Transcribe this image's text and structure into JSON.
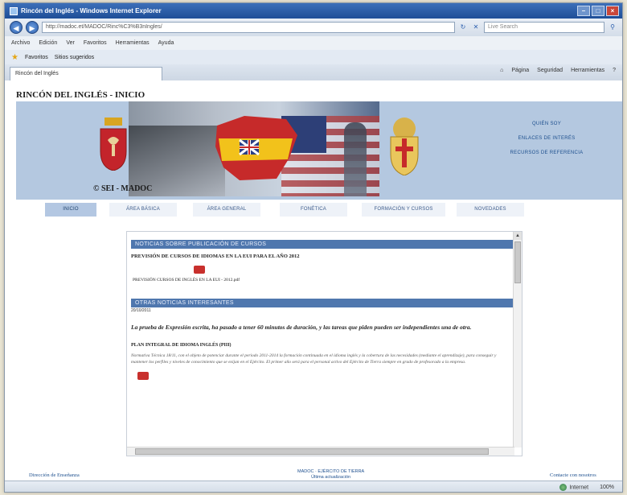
{
  "window": {
    "title": "Rincón del Inglés - Windows Internet Explorer"
  },
  "addressbar": {
    "url": "http://madoc.et/MADOC/Rinc%C3%B3nIngles/",
    "search_placeholder": "Live Search"
  },
  "menubar": {
    "items": [
      "Archivo",
      "Edición",
      "Ver",
      "Favoritos",
      "Herramientas",
      "Ayuda"
    ]
  },
  "favbar": {
    "favorites_label": "Favoritos",
    "suggested_label": "Sitios sugeridos"
  },
  "tabbar": {
    "tab_label": "Rincón del Inglés",
    "tools": [
      "Página",
      "Seguridad",
      "Herramientas"
    ]
  },
  "page": {
    "title": "RINCÓN DEL INGLÉS - INICIO",
    "copyright": "© SEI - MADOC",
    "banner_links": [
      "QUIÉN SOY",
      "ENLACES DE INTERÉS",
      "RECURSOS DE REFERENCIA"
    ],
    "nav": [
      {
        "label": "INICIO",
        "active": true
      },
      {
        "label": "ÁREA BÁSICA",
        "active": false
      },
      {
        "label": "ÁREA GENERAL",
        "active": false
      },
      {
        "label": "FONÉTICA",
        "active": false
      },
      {
        "label": "FORMACIÓN Y CURSOS",
        "active": false
      },
      {
        "label": "NOVEDADES",
        "active": false
      }
    ]
  },
  "panel": {
    "section1_head": "NOTICIAS SOBRE PUBLICACIÓN DE CURSOS",
    "section1_text": "PREVISIÓN DE CURSOS DE IDIOMAS EN LA EUI PARA EL AÑO 2012",
    "pdf_label": "PREVISIÓN CURSOS DE INGLÉS EN LA EUI - 2012.pdf",
    "section2_head": "OTRAS NOTICIAS INTERESANTES",
    "section2_date": "20/10/2011",
    "italic_text": "La prueba de Expresión escrita, ha pasado a tener 60 minutos de duración, y las tareas que piden pueden ser independientes una de otra.",
    "plan_title": "PLAN INTEGRAL DE IDIOMA INGLÉS (PIII)",
    "plan_text": "Normativa Técnica 18/11, con el objeto de potenciar durante el periodo 2011-2014 la formación continuada en el idioma inglés y la cobertura de las necesidades (mediante el aprendizaje), para conseguir y mantener los perfiles y niveles de conocimiento que se exijan en el Ejército. El primer año será para el personal activo del Ejército de Tierra siempre en grado de profesorado a la empresa."
  },
  "footer": {
    "left": "Dirección de Enseñanza",
    "mid_line1": "MADOC · EJÉRCITO DE TIERRA",
    "mid_line2": "Última actualización",
    "right": "Contacte con nosotros"
  },
  "statusbar": {
    "zone": "Internet",
    "zoom": "100%"
  }
}
